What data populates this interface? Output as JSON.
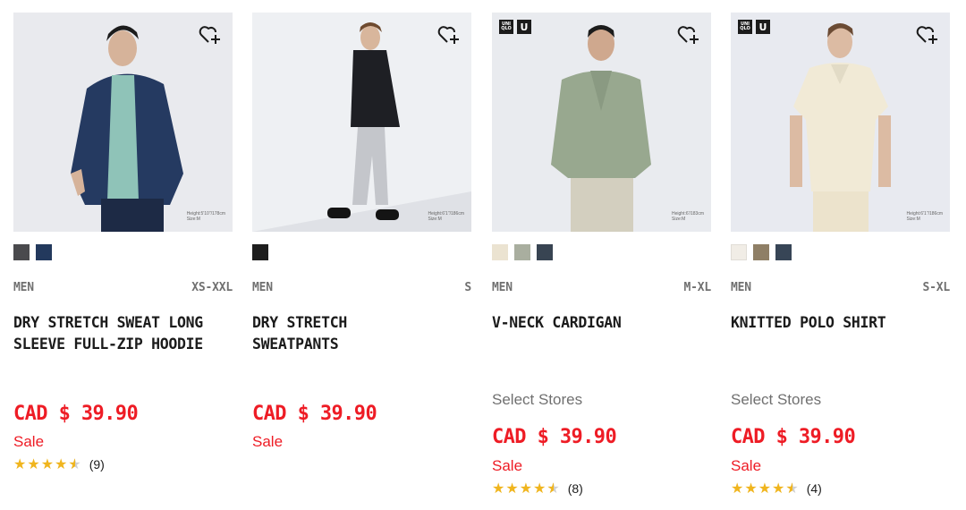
{
  "products": [
    {
      "gender": "MEN",
      "sizes": "XS-XXL",
      "name_line1": "DRY STRETCH SWEAT LONG",
      "name_line2": "SLEEVE FULL-ZIP HOODIE",
      "select_stores": "",
      "price": "CAD $ 39.90",
      "sale": "Sale",
      "rating": 4.5,
      "review_count": "(9)",
      "model_height": "Height:5'10\"/178cm",
      "model_size": "Size:M",
      "badges": false,
      "swatches": [
        "#4a4a4d",
        "#23395d"
      ],
      "wishlist_icon": "heart-plus-icon"
    },
    {
      "gender": "MEN",
      "sizes": "S",
      "name_line1": "DRY STRETCH",
      "name_line2": "SWEATPANTS",
      "select_stores": "",
      "price": "CAD $ 39.90",
      "sale": "Sale",
      "rating": null,
      "review_count": "",
      "model_height": "Height:6'1\"/186cm",
      "model_size": "Size:M",
      "badges": false,
      "swatches": [
        "#1e1e1e"
      ],
      "wishlist_icon": "heart-plus-icon"
    },
    {
      "gender": "MEN",
      "sizes": "M-XL",
      "name_line1": "V-NECK CARDIGAN",
      "name_line2": "",
      "select_stores": "Select Stores",
      "price": "CAD $ 39.90",
      "sale": "Sale",
      "rating": 4.5,
      "review_count": "(8)",
      "model_height": "Height:6'/183cm",
      "model_size": "Size:M",
      "badges": true,
      "swatches": [
        "#ebe3d1",
        "#a9ae9f",
        "#384452"
      ],
      "wishlist_icon": "heart-plus-icon"
    },
    {
      "gender": "MEN",
      "sizes": "S-XL",
      "name_line1": "KNITTED POLO SHIRT",
      "name_line2": "",
      "select_stores": "Select Stores",
      "price": "CAD $ 39.90",
      "sale": "Sale",
      "rating": 4.5,
      "review_count": "(4)",
      "model_height": "Height:6'1\"/186cm",
      "model_size": "Size:M",
      "badges": true,
      "swatches": [
        "#f1ede6",
        "#8f7f66",
        "#374556"
      ],
      "wishlist_icon": "heart-plus-icon"
    }
  ],
  "badge_text": {
    "uniqlo_top": "UNI",
    "uniqlo_bottom": "QLO",
    "u": "U"
  },
  "colors": {
    "price_red": "#ee1c25",
    "star_gold": "#f0b51e",
    "muted_gray": "#707070"
  }
}
